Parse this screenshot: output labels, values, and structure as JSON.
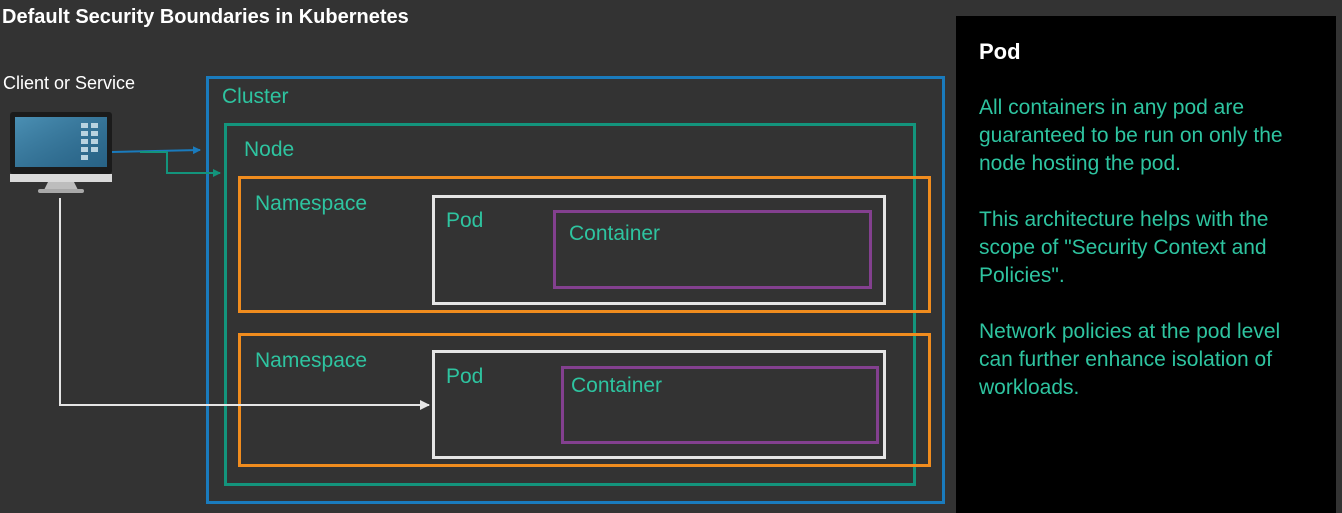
{
  "title": "Default Security Boundaries in Kubernetes",
  "client": {
    "label": "Client or Service",
    "icon": "computer-monitor-icon"
  },
  "diagram": {
    "cluster_label": "Cluster",
    "node_label": "Node",
    "namespaces": [
      {
        "label": "Namespace",
        "pod_label": "Pod",
        "container_label": "Container"
      },
      {
        "label": "Namespace",
        "pod_label": "Pod",
        "container_label": "Container"
      }
    ]
  },
  "panel": {
    "title": "Pod",
    "paragraphs": [
      "All containers in any pod are\nguaranteed to be run on only the\nnode hosting the pod.",
      "This architecture helps with the\nscope of \"Security Context and\nPolicies\".",
      "Network policies at the pod level\ncan further enhance isolation of\nworkloads."
    ]
  },
  "colors": {
    "background": "#333333",
    "cluster": "#1a7bbd",
    "node": "#13947c",
    "namespace": "#f08c1e",
    "pod": "#e5e5e5",
    "container": "#83408f",
    "label_text": "#2ec4a0",
    "panel_background": "#000000"
  }
}
